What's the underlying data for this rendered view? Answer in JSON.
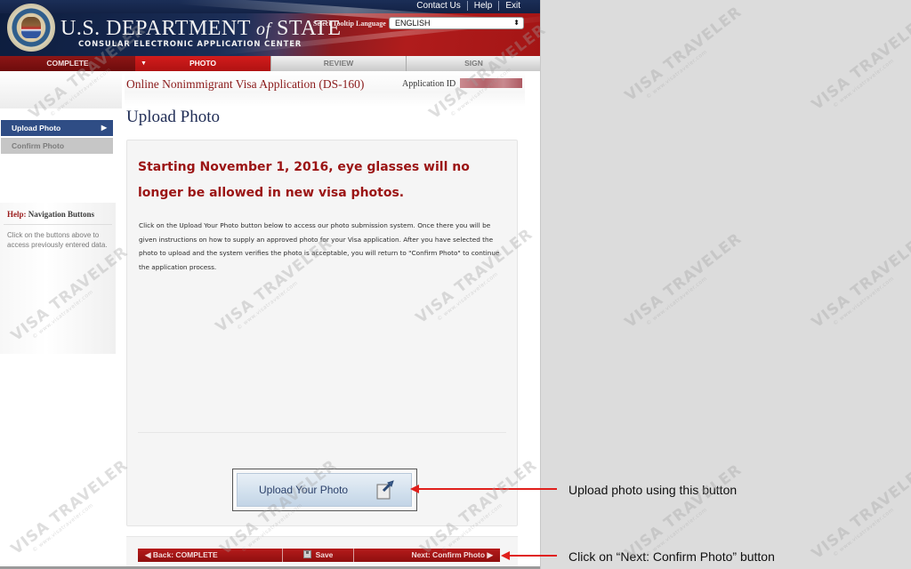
{
  "header": {
    "department_main": "U.S. DEPARTMENT",
    "department_of": "of",
    "department_state": "STATE",
    "department_sub": "CONSULAR ELECTRONIC APPLICATION CENTER",
    "links": [
      "Contact Us",
      "Help",
      "Exit"
    ],
    "tooltip_language_label": "Select Tooltip Language",
    "tooltip_language_selected": "ENGLISH"
  },
  "tabs": [
    {
      "label": "COMPLETE",
      "state": "done"
    },
    {
      "label": "PHOTO",
      "state": "current"
    },
    {
      "label": "REVIEW",
      "state": "todo"
    },
    {
      "label": "SIGN",
      "state": "todo"
    }
  ],
  "app": {
    "title": "Online Nonimmigrant Visa Application (DS-160)",
    "application_id_label": "Application ID"
  },
  "page": {
    "heading": "Upload Photo"
  },
  "sidebar": {
    "items": [
      {
        "label": "Upload Photo",
        "active": true
      },
      {
        "label": "Confirm Photo",
        "active": false
      }
    ],
    "help_prefix": "Help:",
    "help_title": "Navigation Buttons",
    "help_text": "Click on the buttons above to access previously entered data."
  },
  "main": {
    "notice": "Starting November 1, 2016, eye glasses will no longer be allowed in new visa photos.",
    "instructions": "Click on the Upload Your Photo button below to access our photo submission system. Once there you will be given instructions on how to supply an approved photo for your Visa application. After you have selected the photo to upload and the system verifies the photo is acceptable, you will return to \"Confirm Photo\" to continue the application process.",
    "upload_button": "Upload Your Photo"
  },
  "footer": {
    "back_label": "Back: COMPLETE",
    "save_label": "Save",
    "next_label": "Next: Confirm Photo"
  },
  "annotations": {
    "upload_caption": "Upload photo using this button",
    "next_caption": "Click on “Next: Confirm Photo” button",
    "arrow_color": "#e0201c"
  },
  "watermark": {
    "text": "VISA TRAVELER",
    "subtext": "© www.visatraveler.com"
  }
}
